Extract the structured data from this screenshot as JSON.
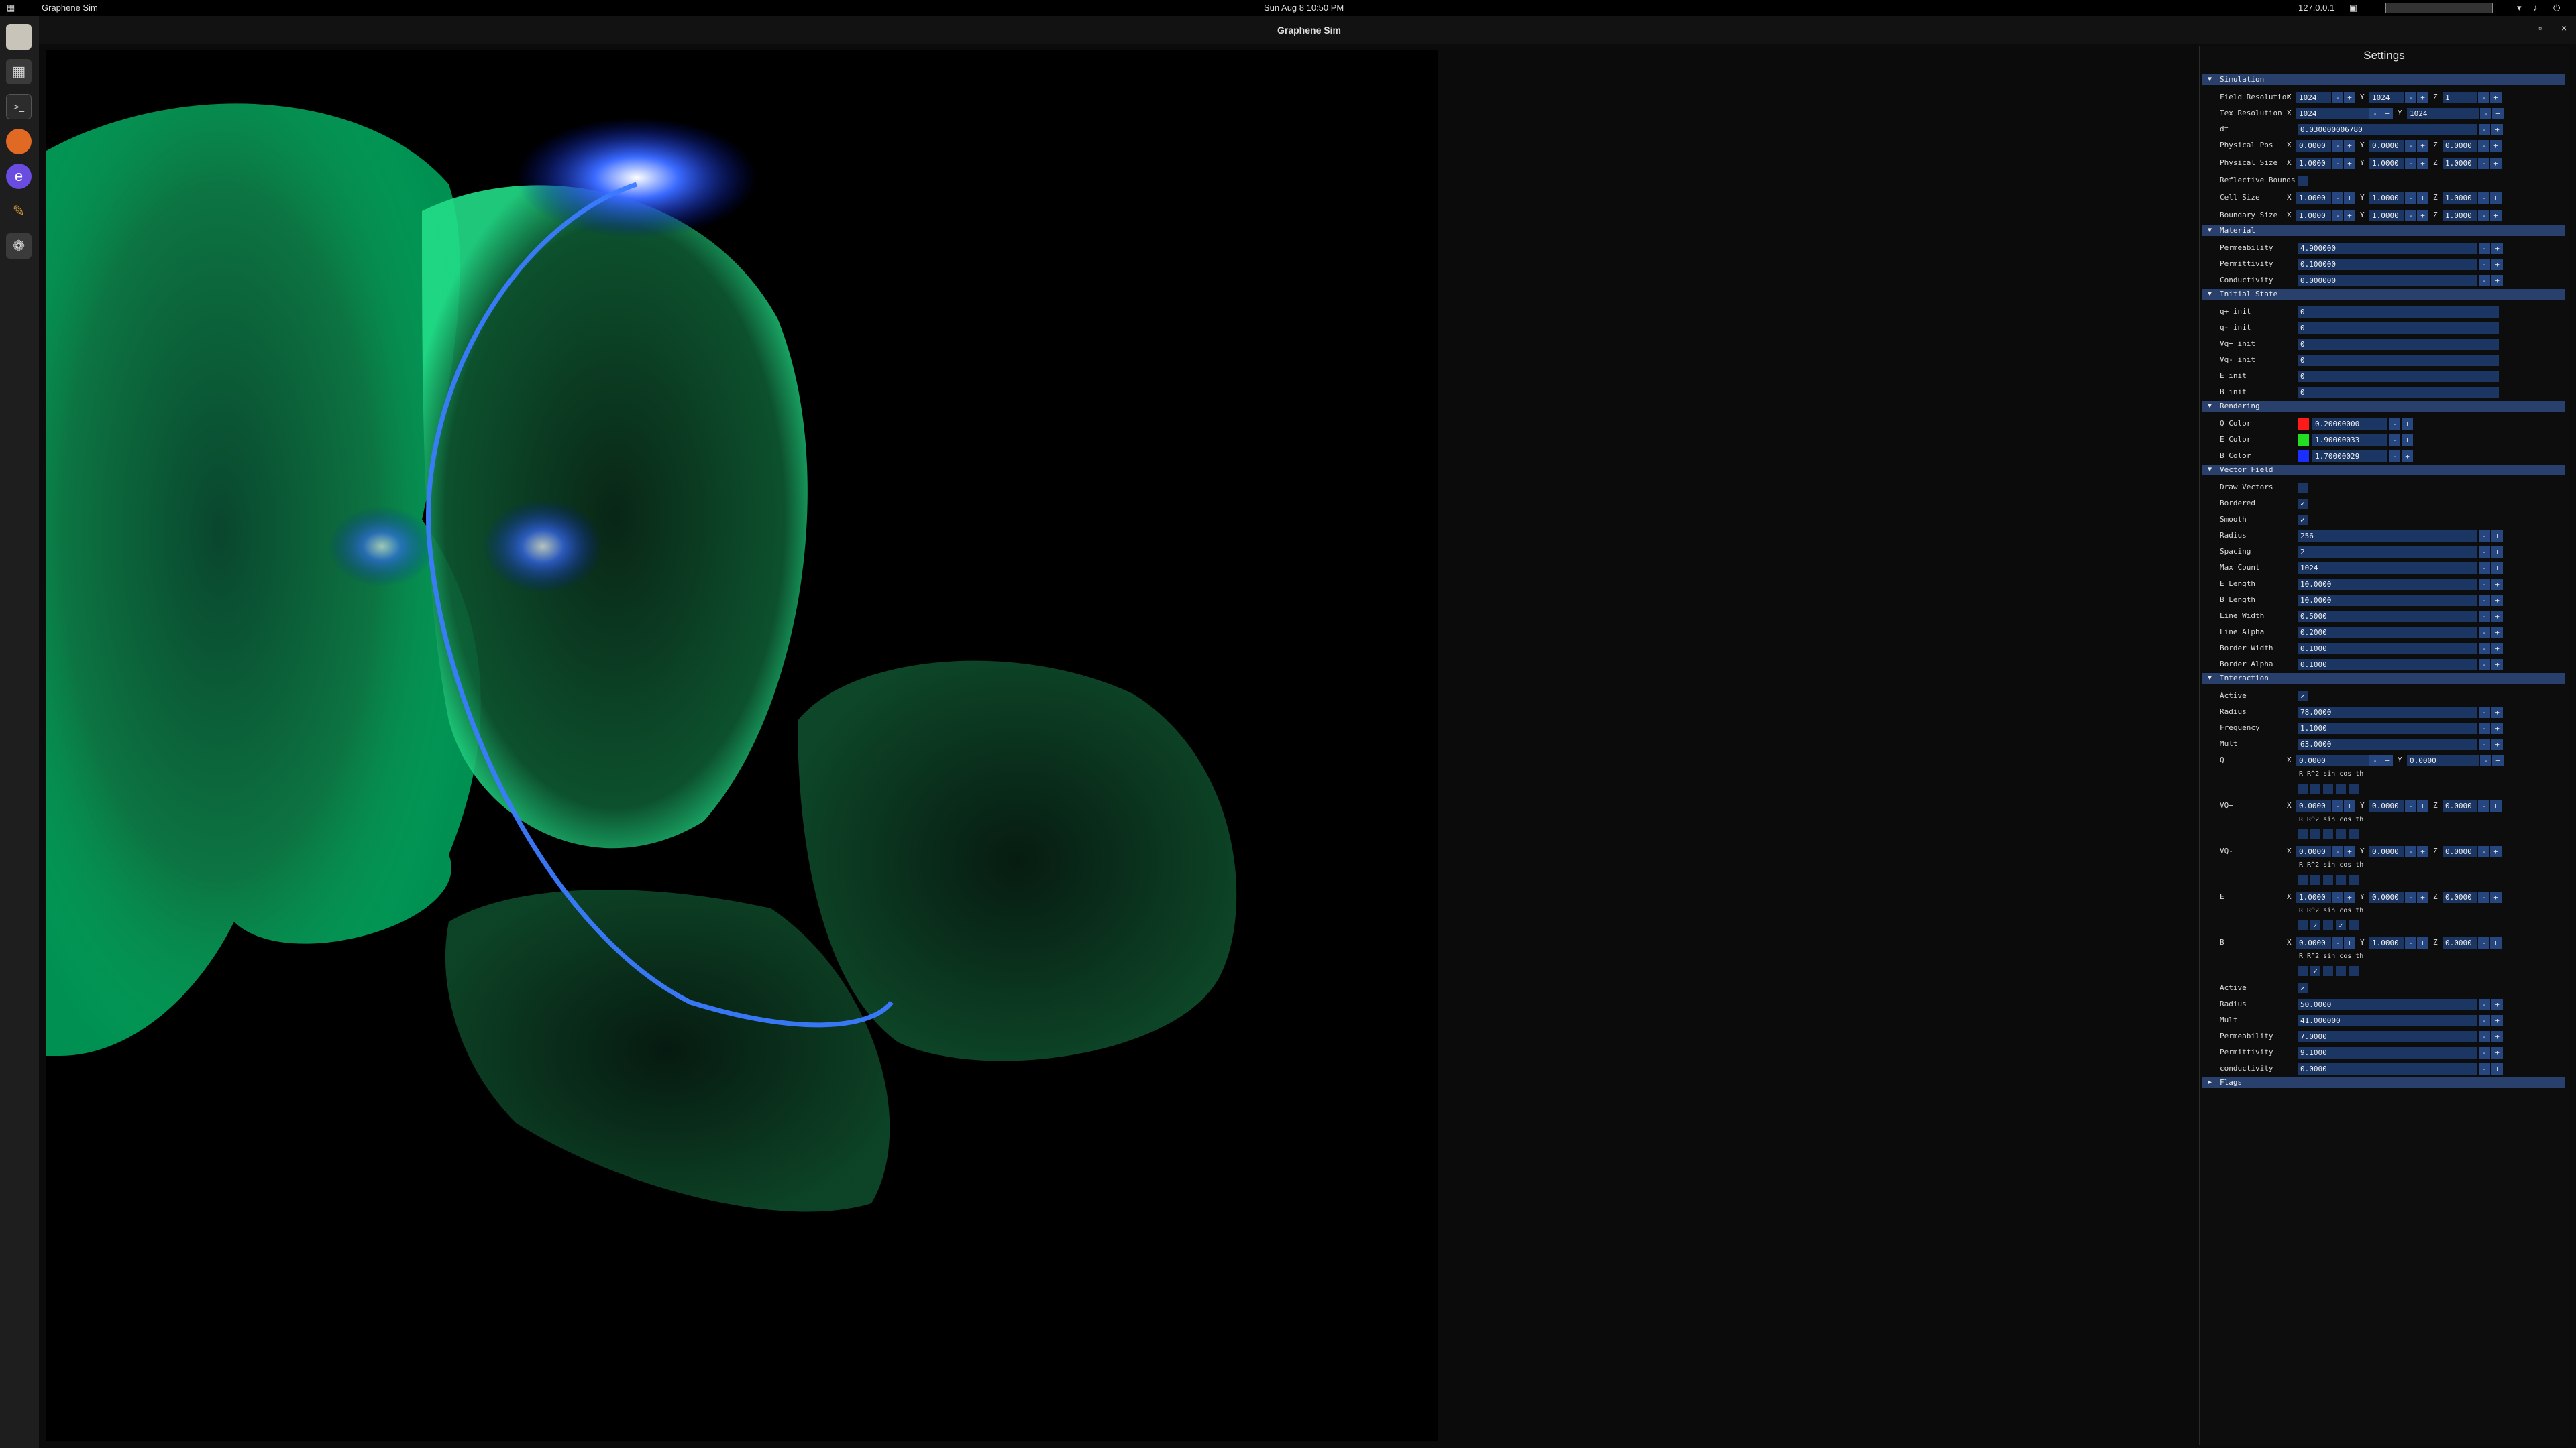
{
  "topbar": {
    "app_name": "Graphene Sim",
    "clock": "Sun Aug 8  10:50 PM",
    "ip": "127.0.0.1"
  },
  "window": {
    "title": "Graphene Sim"
  },
  "panel": {
    "title": "Settings",
    "sections": {
      "simulation": "Simulation",
      "material": "Material",
      "initial_state": "Initial State",
      "rendering": "Rendering",
      "vector_field": "Vector Field",
      "interaction": "Interaction",
      "flags": "Flags"
    },
    "labels": {
      "field_resolution": "Field Resolution",
      "tex_resolution": "Tex Resolution",
      "dt": "dt",
      "physical_pos": "Physical Pos",
      "physical_size": "Physical Size",
      "reflective_bounds": "Reflective Bounds",
      "cell_size": "Cell Size",
      "boundary_size": "Boundary Size",
      "permeability": "Permeability",
      "permittivity": "Permittivity",
      "conductivity": "Conductivity",
      "qp_init": "q+ init",
      "qm_init": "q- init",
      "vqp_init": "Vq+ init",
      "vqm_init": "Vq- init",
      "e_init": "E init",
      "b_init": "B init",
      "q_color": "Q Color",
      "e_color": "E Color",
      "b_color": "B Color",
      "draw_vectors": "Draw Vectors",
      "bordered": "Bordered",
      "smooth": "Smooth",
      "radius": "Radius",
      "spacing": "Spacing",
      "max_count": "Max Count",
      "e_length": "E Length",
      "b_length": "B Length",
      "line_width": "Line Width",
      "line_alpha": "Line Alpha",
      "border_width": "Border Width",
      "border_alpha": "Border Alpha",
      "active": "Active",
      "frequency": "Frequency",
      "mult": "Mult",
      "q": "Q",
      "vqp": "VQ+",
      "vqm": "VQ-",
      "e": "E",
      "b": "B",
      "conductivity_lc": "conductivity"
    },
    "axes": {
      "x": "X",
      "y": "Y",
      "z": "Z"
    },
    "flag_labels": "R  R^2 sin cos th",
    "values": {
      "field_res": [
        "1024",
        "1024",
        "1"
      ],
      "tex_res": [
        "1024",
        "1024"
      ],
      "dt": "0.030000006780",
      "phys_pos": [
        "0.0000",
        "0.0000",
        "0.0000"
      ],
      "phys_size": [
        "1.0000",
        "1.0000",
        "1.0000"
      ],
      "cell_size": [
        "1.0000",
        "1.0000",
        "1.0000"
      ],
      "boundary_size": [
        "1.0000",
        "1.0000",
        "1.0000"
      ],
      "permeability": "4.900000",
      "permittivity": "0.100000",
      "conductivity": "0.000000",
      "qp_init": "0",
      "qm_init": "0",
      "vqp_init": "0",
      "vqm_init": "0",
      "e_init": "0",
      "b_init": "0",
      "q_color": "0.20000000",
      "e_color": "1.90000033",
      "b_color": "1.70000029",
      "vf_radius": "256",
      "vf_spacing": "2",
      "vf_max_count": "1024",
      "vf_e_length": "10.0000",
      "vf_b_length": "10.0000",
      "vf_line_width": "0.5000",
      "vf_line_alpha": "0.2000",
      "vf_border_width": "0.1000",
      "vf_border_alpha": "0.1000",
      "ia_radius": "78.0000",
      "ia_frequency": "1.1000",
      "ia_mult": "63.0000",
      "ia_q": [
        "0.0000",
        "0.0000"
      ],
      "ia_vqp": [
        "0.0000",
        "0.0000",
        "0.0000"
      ],
      "ia_vqm": [
        "0.0000",
        "0.0000",
        "0.0000"
      ],
      "ia_e": [
        "1.0000",
        "0.0000",
        "0.0000"
      ],
      "ia_b": [
        "0.0000",
        "1.0000",
        "0.0000"
      ],
      "m_radius": "50.0000",
      "m_mult": "41.000000",
      "m_permeability": "7.0000",
      "m_permittivity": "9.1000",
      "m_conductivity": "0.0000"
    },
    "colors": {
      "q": "#ff1a1a",
      "e": "#22dd22",
      "b": "#1a2fff"
    }
  },
  "glyphs": {
    "minus": "-",
    "plus": "+",
    "check": "✓",
    "arrow_open": "▼",
    "arrow_closed": "▶"
  }
}
